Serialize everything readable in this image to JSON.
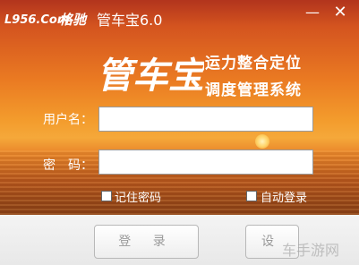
{
  "window": {
    "title": "管车宝6.0",
    "min_label": "—",
    "close_label": "✕"
  },
  "brand": {
    "logo_text": "L956.Com 格驰",
    "big_mark": "管车宝"
  },
  "subtitle": {
    "line1": "运力整合定位",
    "line2": "调度管理系统"
  },
  "form": {
    "username_label": "用户名：",
    "password_label": "密　码：",
    "username_value": "",
    "password_value": ""
  },
  "options": {
    "remember_label": "记住密码",
    "autologin_label": "自动登录"
  },
  "buttons": {
    "login": "登 录",
    "settings": "设 置"
  },
  "watermark": "车手游网"
}
